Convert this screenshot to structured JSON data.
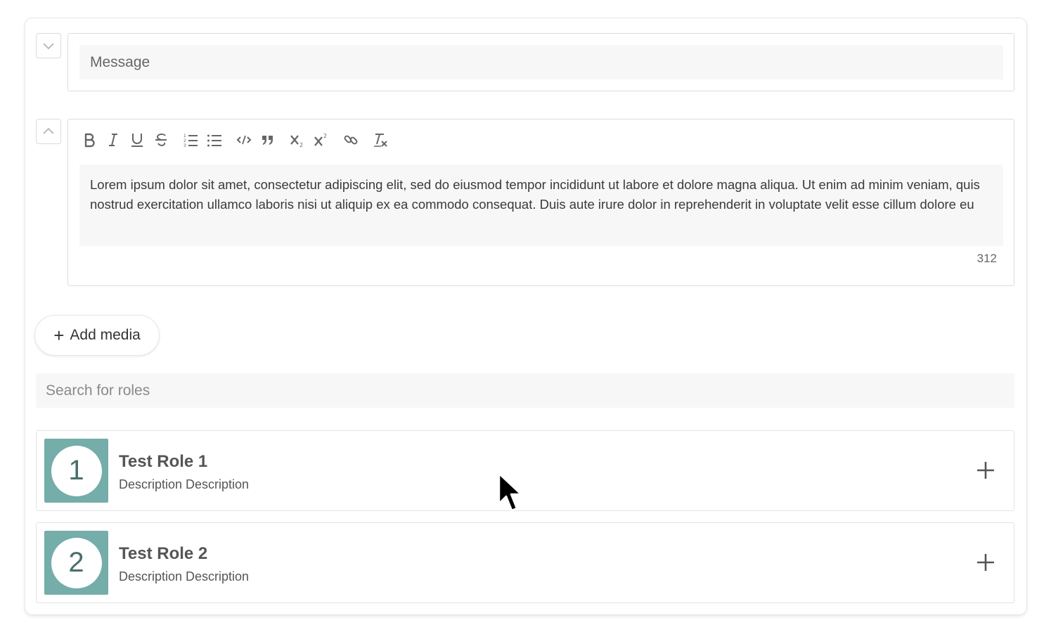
{
  "subject": {
    "placeholder": "Message"
  },
  "editor": {
    "toolbar": [
      {
        "name": "bold-button",
        "icon": "bold-icon"
      },
      {
        "name": "italic-button",
        "icon": "italic-icon"
      },
      {
        "name": "underline-button",
        "icon": "underline-icon"
      },
      {
        "name": "strikethrough-button",
        "icon": "strikethrough-icon"
      },
      {
        "name": "ordered-list-button",
        "icon": "ordered-list-icon"
      },
      {
        "name": "bullet-list-button",
        "icon": "bullet-list-icon"
      },
      {
        "name": "code-button",
        "icon": "code-icon"
      },
      {
        "name": "blockquote-button",
        "icon": "quote-icon"
      },
      {
        "name": "subscript-button",
        "icon": "subscript-icon"
      },
      {
        "name": "superscript-button",
        "icon": "superscript-icon"
      },
      {
        "name": "link-button",
        "icon": "link-icon"
      },
      {
        "name": "clear-format-button",
        "icon": "clear-format-icon"
      }
    ],
    "content": "Lorem ipsum dolor sit amet, consectetur adipiscing elit, sed do eiusmod tempor incididunt ut labore et dolore magna aliqua. Ut enim ad minim veniam, quis nostrud exercitation ullamco laboris nisi ut aliquip ex ea commodo consequat. Duis aute irure dolor in reprehenderit in voluptate velit esse cillum dolore eu",
    "char_count": "312"
  },
  "add_media": {
    "label": "Add media"
  },
  "role_search": {
    "placeholder": "Search for roles"
  },
  "roles": [
    {
      "number": "1",
      "name": "Test Role 1",
      "description": "Description Description"
    },
    {
      "number": "2",
      "name": "Test Role 2",
      "description": "Description Description"
    }
  ],
  "colors": {
    "role_avatar_bg": "#74ada9",
    "border": "#dcdcdc",
    "field_bg": "#f7f7f7"
  }
}
